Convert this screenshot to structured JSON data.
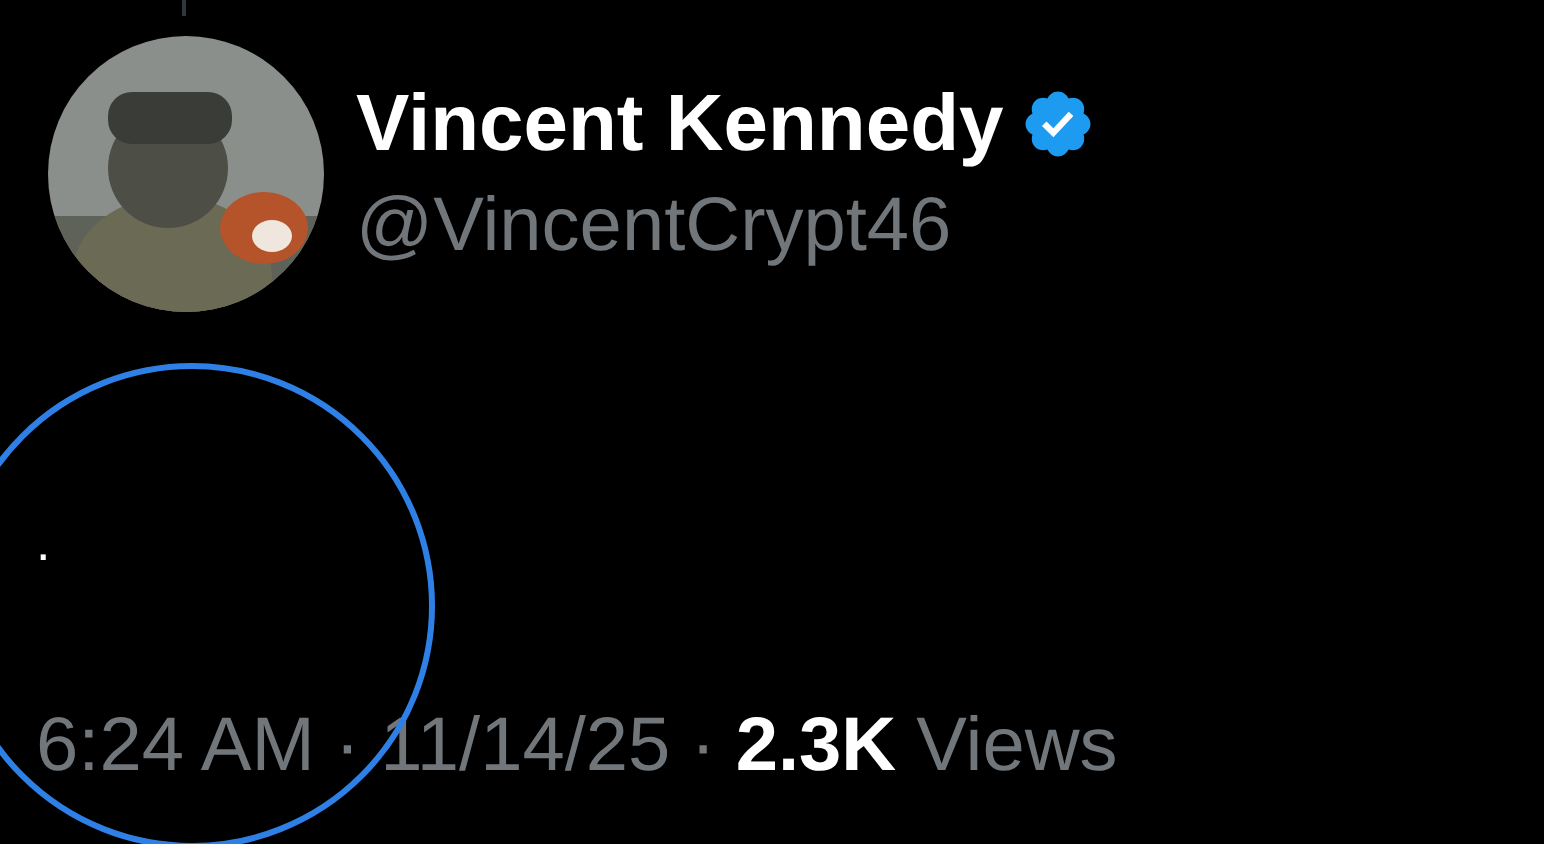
{
  "author": {
    "name": "Vincent Kennedy",
    "verified": true,
    "handle": "@VincentCrypt46"
  },
  "text": ".",
  "meta": {
    "time": "6:24 AM",
    "separator_1": "·",
    "date": "11/14/25",
    "separator_2": "·",
    "views_count": "2.3K",
    "views_label": "Views"
  },
  "annotation": {
    "kind": "circle"
  }
}
